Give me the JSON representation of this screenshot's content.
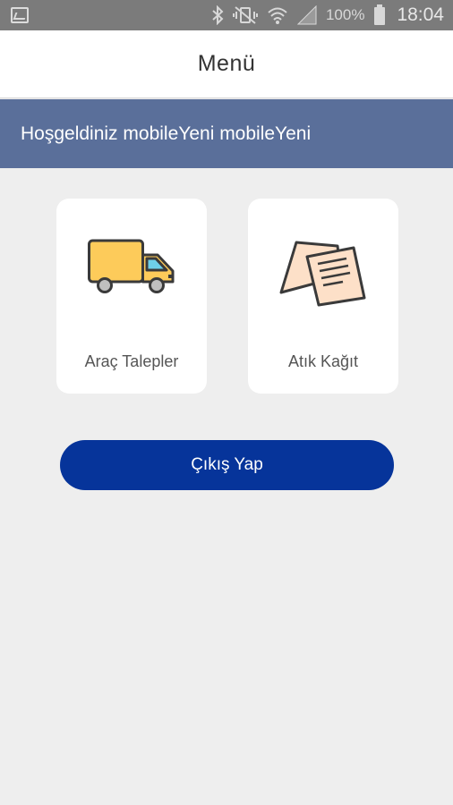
{
  "status_bar": {
    "battery_percent": "100%",
    "time": "18:04",
    "icons": [
      "gallery-icon",
      "bluetooth-icon",
      "mute-vibrate-icon",
      "wifi-icon",
      "signal-icon",
      "battery-icon"
    ]
  },
  "app_bar": {
    "title": "Menü"
  },
  "welcome": {
    "text": "Hoşgeldiniz mobileYeni mobileYeni"
  },
  "tiles": [
    {
      "label": "Araç Talepler",
      "icon": "truck-icon"
    },
    {
      "label": "Atık Kağıt",
      "icon": "papers-icon"
    }
  ],
  "logout": {
    "label": "Çıkış Yap"
  },
  "colors": {
    "status_bar": "#7b7b7b",
    "welcome_bg": "#5a6f9a",
    "logout_bg": "#06349a",
    "page_bg": "#eeeeee",
    "truck_body": "#fdcb5a",
    "truck_window": "#6ed0e8",
    "paper": "#fde0c8"
  }
}
